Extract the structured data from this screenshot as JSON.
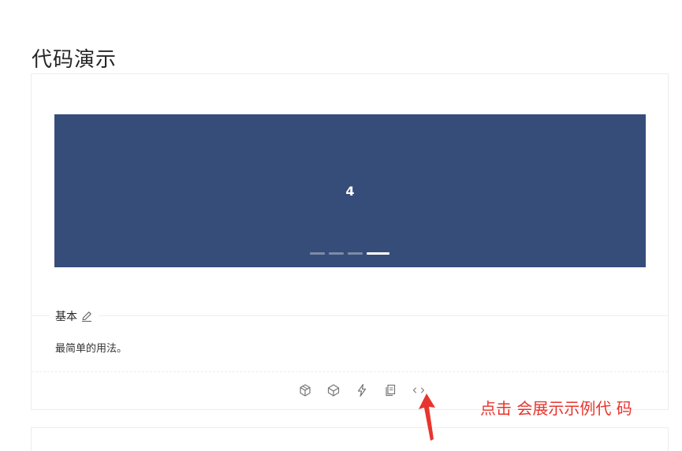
{
  "page": {
    "title": "代码演示"
  },
  "demo": {
    "carousel": {
      "current_slide": "4",
      "slide_count": 4,
      "active_index": 3,
      "background": "#364d79"
    },
    "meta": {
      "title": "基本",
      "description": "最简单的用法。"
    },
    "actions": [
      {
        "name": "codesandbox-icon"
      },
      {
        "name": "codepen-icon"
      },
      {
        "name": "riddle-icon"
      },
      {
        "name": "copy-icon"
      },
      {
        "name": "expand-code-icon"
      }
    ]
  },
  "annotation": {
    "text": "点击 会展示示例代 码",
    "color": "#e8352e"
  }
}
